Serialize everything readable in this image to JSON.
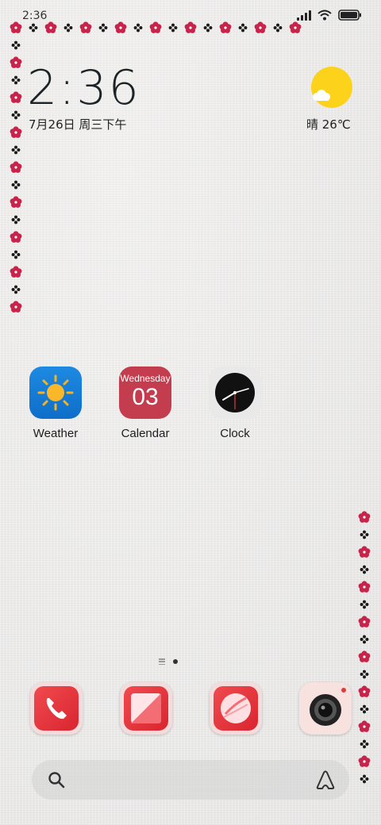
{
  "status_bar": {
    "time": "2:36",
    "icons": [
      "signal-icon",
      "wifi-icon",
      "battery-icon"
    ]
  },
  "clock_widget": {
    "time": "2:36",
    "date": "7月26日 周三下午"
  },
  "weather_widget": {
    "icon": "partly-sunny-icon",
    "text": "晴 26℃"
  },
  "apps": [
    {
      "label": "Weather",
      "icon": "sun-icon"
    },
    {
      "label": "Calendar",
      "icon": "calendar-icon",
      "day_name": "Wednesday",
      "day_number": "03"
    },
    {
      "label": "Clock",
      "icon": "clock-icon"
    }
  ],
  "dock": [
    {
      "icon": "phone-icon"
    },
    {
      "icon": "notes-icon"
    },
    {
      "icon": "browser-icon"
    },
    {
      "icon": "camera-icon"
    }
  ],
  "search_bar": {
    "search_icon": "search-icon",
    "assistant_icon": "assistant-icon"
  },
  "page_indicator": {
    "pages": 2,
    "current": 2
  },
  "colors": {
    "flower_red": "#c8234a",
    "flower_black": "#1a1a1a",
    "accent_red": "#e52d36",
    "weather_blue": "#1278d6",
    "calendar_red": "#c43d4e",
    "sun_yellow": "#fcd21a"
  }
}
